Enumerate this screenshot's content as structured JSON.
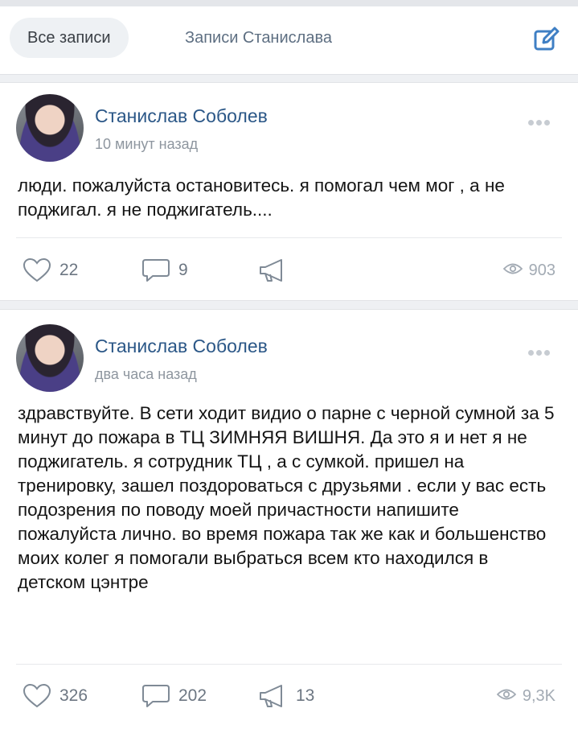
{
  "tabs": [
    {
      "label": "Все записи"
    },
    {
      "label": "Записи Станислава"
    }
  ],
  "posts": [
    {
      "author": "Станислав Соболев",
      "time": "10 минут назад",
      "text": "люди. пожалуйста остановитесь. я помогал чем мог , а не поджигал. я не поджигатель....",
      "likes": "22",
      "comments": "9",
      "shares": "",
      "views": "903"
    },
    {
      "author": "Станислав Соболев",
      "time": "два часа назад",
      "text": "здравствуйте. В сети ходит видио о парне с черной сумной за 5 минут до пожара в ТЦ ЗИМНЯЯ ВИШНЯ. Да это я и нет я не поджигатель. я сотрудник ТЦ , а с сумкой. пришел на тренировку, зашел поздороваться с друзьями . если у вас есть подозрения по поводу моей причастности напишите пожалуйста лично. во время пожара так же как и большенство моих колег я помогали выбраться всем кто находился в детском цэнтре",
      "likes": "326",
      "comments": "202",
      "shares": "13",
      "views": "9,3K"
    }
  ],
  "colors": {
    "accent": "#2b5787",
    "icon": "#5e6f82",
    "edit_icon": "#3f7fc4",
    "background": "#eef0f3"
  },
  "icons": {
    "edit": "pencil-square-icon",
    "like": "heart-icon",
    "comment": "comment-bubble-icon",
    "share": "megaphone-icon",
    "views": "eye-icon",
    "more": "more-dots-icon"
  }
}
